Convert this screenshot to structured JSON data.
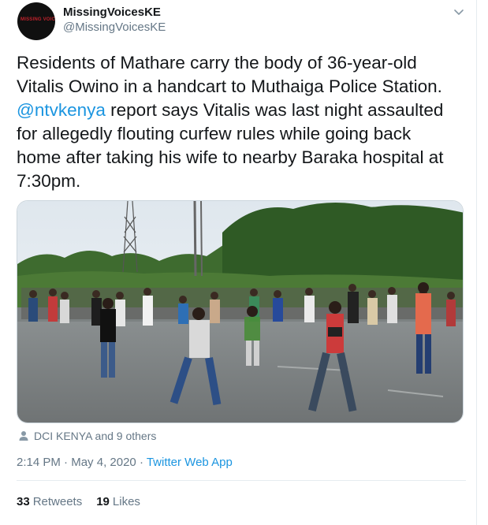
{
  "user": {
    "display_name": "MissingVoicesKE",
    "handle": "@MissingVoicesKE",
    "avatar_text": "MISSING VOICES"
  },
  "tweet": {
    "lines": [
      "Residents of Mathare carry the body of 36-year-old",
      "Vitalis Owino in a handcart to Muthaiga Police Station."
    ],
    "mention": "@ntvkenya",
    "line3_rest": " report says Vitalis was last night assaulted",
    "lines_after": [
      "for allegedly flouting curfew rules while going back",
      "home after taking his wife to nearby Baraka hospital at",
      "7:30pm."
    ]
  },
  "tagged": "DCI KENYA and 9 others",
  "meta": {
    "time": "2:14 PM",
    "separator1": " · ",
    "date": "May 4, 2020",
    "separator2": " · ",
    "app": "Twitter Web App"
  },
  "stats": {
    "retweets_count": "33",
    "retweets_label": "Retweets",
    "likes_count": "19",
    "likes_label": "Likes"
  },
  "icons": {
    "caret": "chevron-down-icon",
    "tagged": "person-icon"
  },
  "colors": {
    "link": "#1b95e0",
    "secondary_text": "#657786",
    "primary_text": "#14171a"
  }
}
